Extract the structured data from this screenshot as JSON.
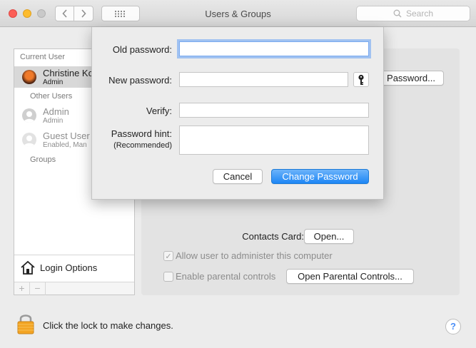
{
  "window": {
    "title": "Users & Groups",
    "search_placeholder": "Search"
  },
  "sidebar": {
    "current_user_header": "Current User",
    "current_user": {
      "name": "Christine Ko",
      "role": "Admin"
    },
    "other_users_header": "Other Users",
    "other_users": [
      {
        "name": "Admin",
        "role": "Admin"
      },
      {
        "name": "Guest User",
        "role": "Enabled, Man"
      }
    ],
    "groups_label": "Groups",
    "login_options_label": "Login Options",
    "add_label": "+",
    "remove_label": "−"
  },
  "panel": {
    "change_password_button": "Password...",
    "contacts_card_label": "Contacts Card:",
    "open_button": "Open...",
    "allow_admin_label": "Allow user to administer this computer",
    "allow_admin_checked": true,
    "parental_controls_label": "Enable parental controls",
    "parental_controls_checked": false,
    "open_parental_controls_button": "Open Parental Controls..."
  },
  "footer": {
    "lock_text": "Click the lock to make changes.",
    "help_label": "?"
  },
  "dialog": {
    "old_password_label": "Old password:",
    "old_password_value": "",
    "new_password_label": "New password:",
    "new_password_value": "",
    "verify_label": "Verify:",
    "verify_value": "",
    "hint_label": "Password hint:",
    "hint_sublabel": "(Recommended)",
    "hint_value": "",
    "cancel_button": "Cancel",
    "submit_button": "Change Password"
  },
  "colors": {
    "accent": "#1d86f5",
    "focus_ring": "#7aaaf0",
    "lock": "#f3a423"
  }
}
